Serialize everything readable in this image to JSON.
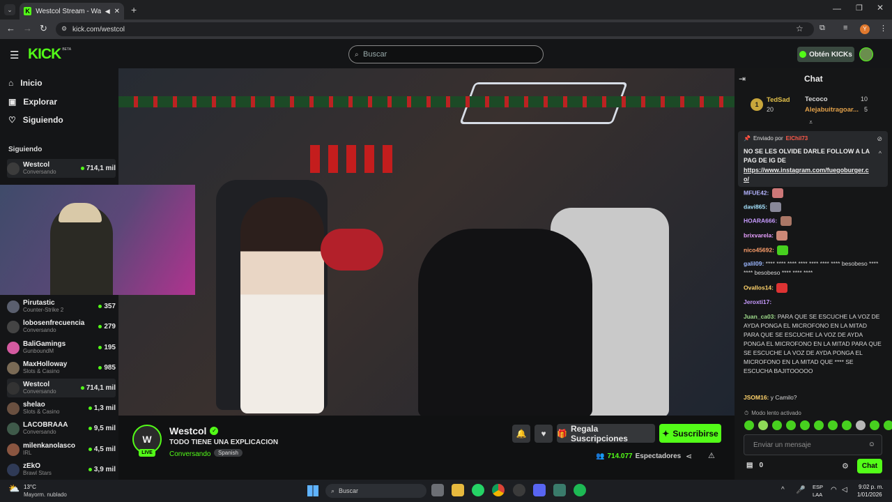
{
  "browser": {
    "tab_title": "Westcol Stream - Watch Li",
    "url": "kick.com/westcol",
    "profile_initial": "Y"
  },
  "header": {
    "logo": "KICK",
    "beta": "BETA",
    "search_placeholder": "Buscar",
    "cta": "Obtén KICKs"
  },
  "nav": {
    "items": [
      "Inicio",
      "Explorar",
      "Siguiendo"
    ],
    "section": "Siguiendo"
  },
  "following": [
    {
      "name": "Westcol",
      "sub": "Conversando",
      "viewers": "714,1 mil"
    }
  ],
  "channels": [
    {
      "name": "Pirutastic",
      "sub": "Counter-Strike 2",
      "viewers": "357"
    },
    {
      "name": "lobosenfrecuencia",
      "sub": "Conversando",
      "viewers": "279"
    },
    {
      "name": "BaliGamings",
      "sub": "GunboundM",
      "viewers": "195"
    },
    {
      "name": "MaxHolloway",
      "sub": "Slots & Casino",
      "viewers": "985"
    },
    {
      "name": "Westcol",
      "sub": "Conversando",
      "viewers": "714,1 mil"
    },
    {
      "name": "shelao",
      "sub": "Slots & Casino",
      "viewers": "1,3 mil"
    },
    {
      "name": "LACOBRAAA",
      "sub": "Conversando",
      "viewers": "9,5 mil"
    },
    {
      "name": "milenkanolasco",
      "sub": "IRL",
      "viewers": "4,5 mil"
    },
    {
      "name": "zEkO",
      "sub": "Brawl Stars",
      "viewers": "3,9 mil"
    }
  ],
  "stream": {
    "name": "Westcol",
    "title": "TODO TIENE UNA EXPLICACION",
    "category": "Conversando",
    "language": "Spanish",
    "live": "LIVE",
    "gift": "Regala Suscripciones",
    "subscribe": "Suscribirse",
    "viewers": "714.077",
    "viewers_label": "Espectadores"
  },
  "chat": {
    "title": "Chat",
    "leader": {
      "rank": "1",
      "name": "TedSad",
      "count": "20",
      "name2": "Tecoco",
      "count2": "10",
      "name3": "Alejabuitragoar...",
      "count3": "5"
    },
    "pinned": {
      "by": "Enviado por",
      "user": "ElChil73",
      "text": "NO SE LES OLVIDE DARLE FOLLOW A LA PAG DE IG DE",
      "link": "https://www.instagram.com/fuegoburger.co/"
    },
    "messages": [
      {
        "user": "MFUE42:",
        "text": "",
        "color": "#b4b4ff"
      },
      {
        "user": "davi865:",
        "text": "",
        "color": "#a6e3ff"
      },
      {
        "user": "HOARA666:",
        "text": "",
        "color": "#c79bff"
      },
      {
        "user": "brixvarela:",
        "text": "",
        "color": "#e8a0ff"
      },
      {
        "user": "nico45692:",
        "text": "",
        "color": "#ff9f6b"
      },
      {
        "user": "galil09:",
        "text": "**** **** **** **** **** **** **** besobeso **** **** besobeso **** **** ****",
        "color": "#9bb7ff"
      },
      {
        "user": "Ovallos14:",
        "text": "",
        "color": "#ffd36b"
      },
      {
        "user": "Jeroxti17:",
        "text": "",
        "color": "#c79bff"
      },
      {
        "user": "Juan_ca03:",
        "text": "PARA QUE SE ESCUCHE LA VOZ DE AYDA PONGA EL MICROFONO EN LA MITAD PARA QUE SE ESCUCHE LA VOZ DE AYDA PONGA EL MICROFONO EN LA MITAD PARA QUE SE ESCUCHE LA VOZ DE AYDA PONGA EL MICROFONO EN LA MITAD QUE **** SE ESCUCHA BAJITOOOOO",
        "color": "#9fdc8b"
      },
      {
        "user": "JSOM16:",
        "text": "y Camilo?",
        "color": "#ffd36b"
      }
    ],
    "slow_mode": "Modo lento activado",
    "input_placeholder": "Enviar un mensaje",
    "points": "0",
    "send": "Chat"
  },
  "taskbar": {
    "weather_temp": "13°C",
    "weather_desc": "Mayorm. nublado",
    "search": "Buscar",
    "lang": "ESP",
    "lang2": "LAA",
    "time": "9:02 p. m.",
    "date": "1/01/2026"
  },
  "colors": {
    "accent": "#53fc18"
  }
}
